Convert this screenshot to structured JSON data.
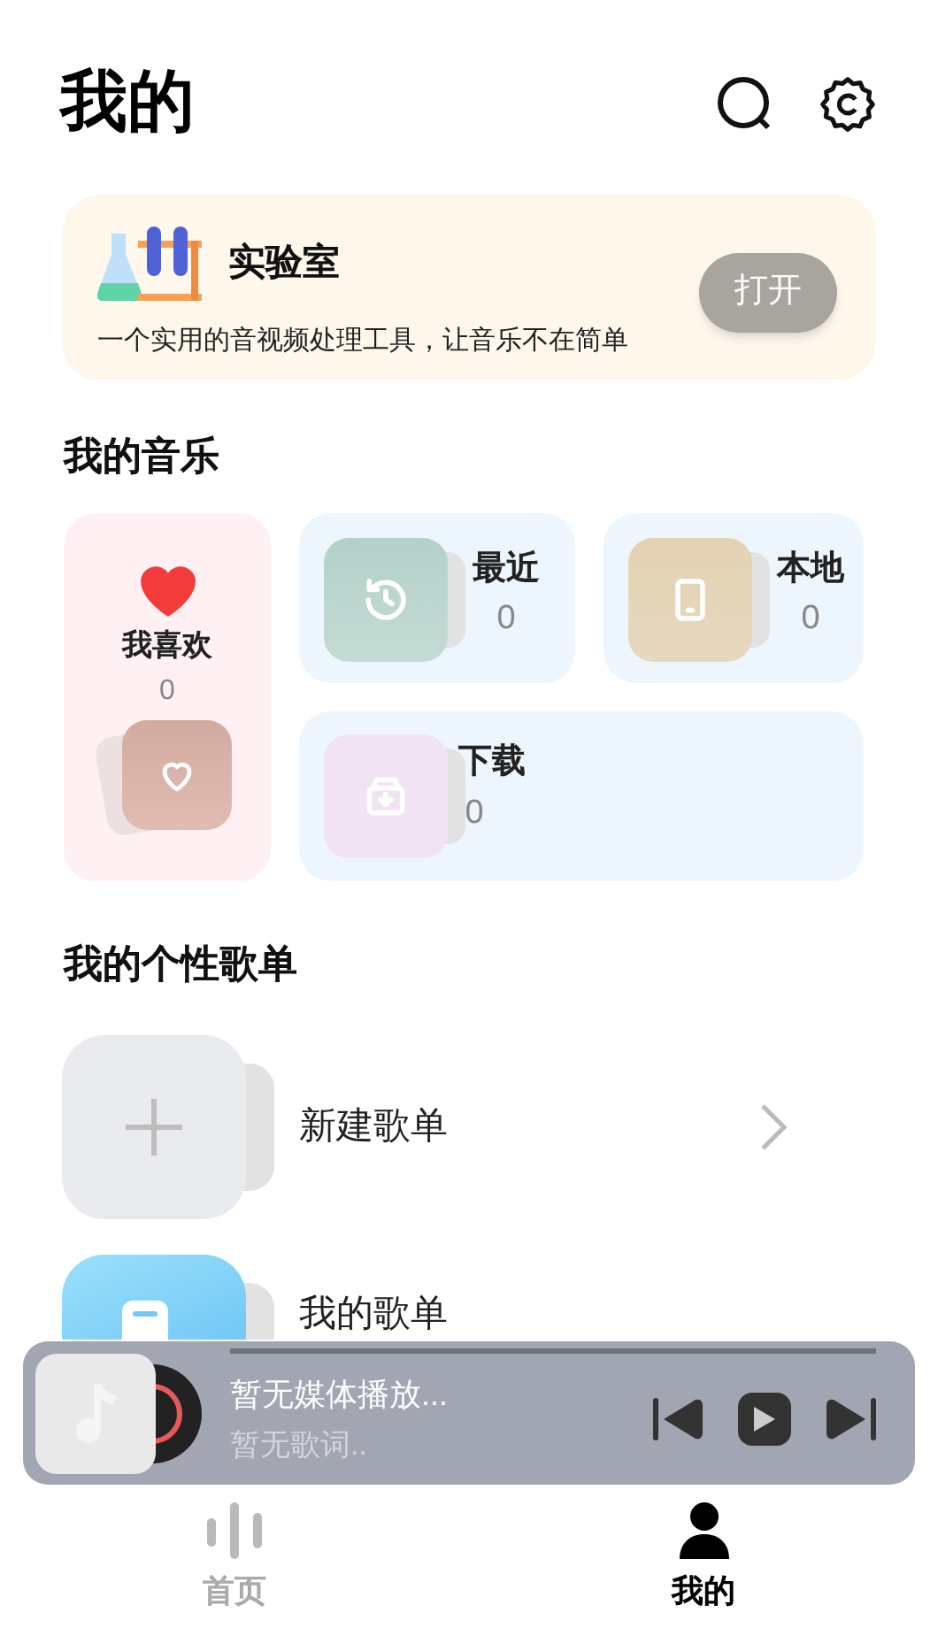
{
  "header": {
    "title": "我的"
  },
  "lab": {
    "title": "实验室",
    "description": "一个实用的音视频处理工具，让音乐不在简单",
    "button": "打开"
  },
  "music": {
    "title": "我的音乐",
    "cards": [
      {
        "kind": "favorite",
        "label": "我喜欢",
        "count": "0"
      },
      {
        "kind": "recent",
        "label": "最近",
        "count": "0"
      },
      {
        "kind": "local",
        "label": "本地",
        "count": "0"
      },
      {
        "kind": "download",
        "label": "下载",
        "count": "0"
      }
    ]
  },
  "playlists": {
    "title": "我的个性歌单",
    "items": [
      {
        "kind": "create",
        "title": "新建歌单"
      },
      {
        "kind": "playlist",
        "title": "我的歌单"
      }
    ]
  },
  "player": {
    "title": "暂无媒体播放...",
    "lyrics": "暂无歌词..",
    "playing": false
  },
  "nav": [
    {
      "kind": "home",
      "label": "首页",
      "selected": false
    },
    {
      "kind": "me",
      "label": "我的",
      "selected": true
    }
  ]
}
